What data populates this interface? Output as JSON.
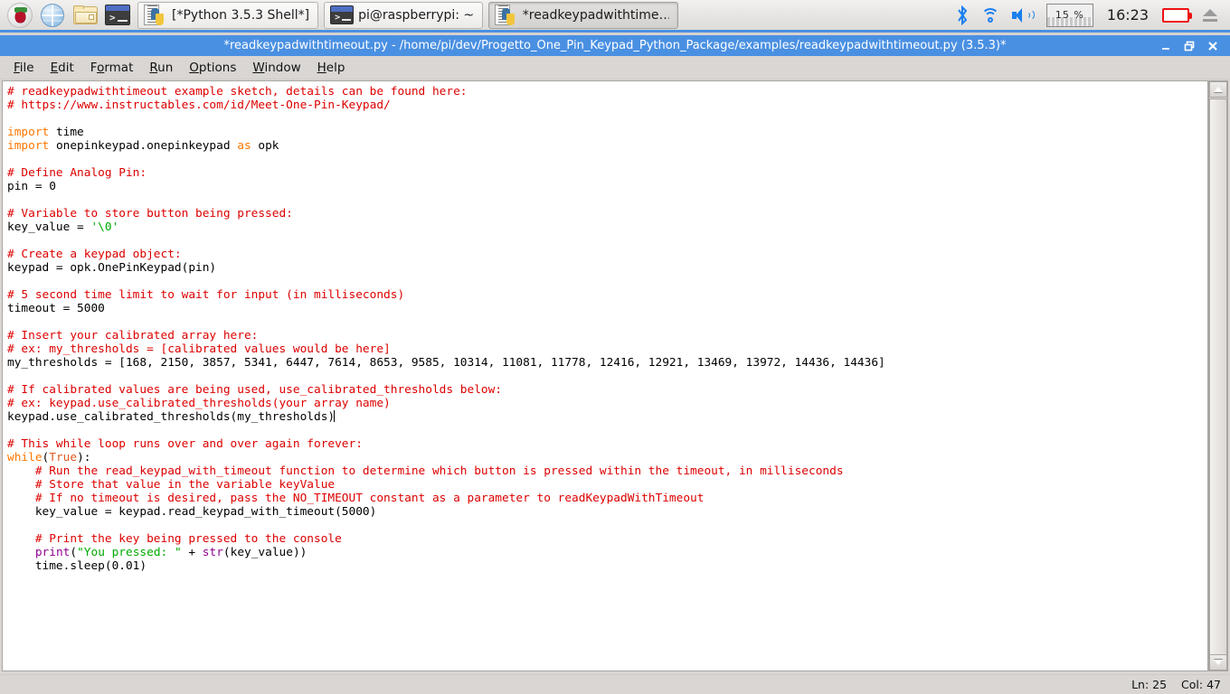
{
  "taskbar": {
    "launchers": [
      {
        "name": "raspberry-menu-icon",
        "label": "Raspberry Pi Menu"
      },
      {
        "name": "web-browser-icon",
        "label": "Web Browser"
      },
      {
        "name": "file-manager-icon",
        "label": "File Manager"
      },
      {
        "name": "terminal-icon",
        "label": "Terminal"
      }
    ],
    "windows": [
      {
        "label": "[*Python 3.5.3 Shell*]",
        "icon": "python-idle-icon",
        "active": false
      },
      {
        "label": "pi@raspberrypi: ~",
        "icon": "terminal-icon",
        "active": false
      },
      {
        "label": "*readkeypadwithtime…",
        "icon": "python-idle-icon",
        "active": true
      }
    ],
    "tray": {
      "bluetooth": "bluetooth-icon",
      "wifi": "wifi-icon",
      "volume": "volume-icon",
      "cpu_label": "15 %",
      "clock": "16:23",
      "battery": "battery-icon",
      "eject": "eject-icon"
    }
  },
  "window": {
    "title": "*readkeypadwithtimeout.py - /home/pi/dev/Progetto_One_Pin_Keypad_Python_Package/examples/readkeypadwithtimeout.py (3.5.3)*",
    "buttons": {
      "minimize": "minimize-button",
      "maximize": "maximize-button",
      "close": "close-button"
    }
  },
  "menubar": [
    {
      "label": "File",
      "mnemonic": "F"
    },
    {
      "label": "Edit",
      "mnemonic": "E"
    },
    {
      "label": "Format",
      "mnemonic": "o"
    },
    {
      "label": "Run",
      "mnemonic": "R"
    },
    {
      "label": "Options",
      "mnemonic": "O"
    },
    {
      "label": "Window",
      "mnemonic": "W"
    },
    {
      "label": "Help",
      "mnemonic": "H"
    }
  ],
  "statusbar": {
    "line_label": "Ln: 25",
    "col_label": "Col: 47"
  },
  "editor": {
    "language": "python",
    "colors": {
      "comment": "#dd0000",
      "keyword": "#ff7700",
      "builtin": "#900090",
      "string": "#00aa00",
      "definition": "#e05a20",
      "text": "#000000",
      "background": "#ffffff"
    },
    "thresholds": [
      168,
      2150,
      3857,
      5341,
      6447,
      7614,
      8653,
      9585,
      10314,
      11081,
      11778,
      12416,
      12921,
      13469,
      13972,
      14436,
      14436
    ],
    "lines": [
      [
        {
          "t": "# readkeypadwithtimeout example sketch, details can be found here:",
          "c": "c"
        }
      ],
      [
        {
          "t": "# https://www.instructables.com/id/Meet-One-Pin-Keypad/",
          "c": "c"
        }
      ],
      [],
      [
        {
          "t": "import",
          "c": "k"
        },
        {
          "t": " time",
          "c": "n"
        }
      ],
      [
        {
          "t": "import",
          "c": "k"
        },
        {
          "t": " onepinkeypad.onepinkeypad ",
          "c": "n"
        },
        {
          "t": "as",
          "c": "k"
        },
        {
          "t": " opk",
          "c": "n"
        }
      ],
      [],
      [
        {
          "t": "# Define Analog Pin:",
          "c": "c"
        }
      ],
      [
        {
          "t": "pin = 0",
          "c": "n"
        }
      ],
      [],
      [
        {
          "t": "# Variable to store button being pressed:",
          "c": "c"
        }
      ],
      [
        {
          "t": "key_value = ",
          "c": "n"
        },
        {
          "t": "'\\0'",
          "c": "s"
        }
      ],
      [],
      [
        {
          "t": "# Create a keypad object:",
          "c": "c"
        }
      ],
      [
        {
          "t": "keypad = opk.OnePinKeypad(pin)",
          "c": "n"
        }
      ],
      [],
      [
        {
          "t": "# 5 second time limit to wait for input (in milliseconds)",
          "c": "c"
        }
      ],
      [
        {
          "t": "timeout = 5000",
          "c": "n"
        }
      ],
      [],
      [
        {
          "t": "# Insert your calibrated array here:",
          "c": "c"
        }
      ],
      [
        {
          "t": "# ex: my_thresholds = [calibrated values would be here]",
          "c": "c"
        }
      ],
      [
        {
          "t": "my_thresholds = [168, 2150, 3857, 5341, 6447, 7614, 8653, 9585, 10314, 11081, 11778, 12416, 12921, 13469, 13972, 14436, 14436]",
          "c": "n"
        }
      ],
      [],
      [
        {
          "t": "# If calibrated values are being used, use_calibrated_thresholds below:",
          "c": "c"
        }
      ],
      [
        {
          "t": "# ex: keypad.use_calibrated_thresholds(your array name)",
          "c": "c"
        }
      ],
      [
        {
          "t": "keypad.use_calibrated_thresholds(my_thresholds)",
          "c": "n"
        },
        {
          "t": "",
          "c": "caret"
        }
      ],
      [],
      [
        {
          "t": "# This while loop runs over and over again forever:",
          "c": "c"
        }
      ],
      [
        {
          "t": "while",
          "c": "k"
        },
        {
          "t": "(",
          "c": "n"
        },
        {
          "t": "True",
          "c": "d"
        },
        {
          "t": "):",
          "c": "n"
        }
      ],
      [
        {
          "t": "    # Run the read_keypad_with_timeout function to determine which button is pressed within the timeout, in milliseconds",
          "c": "c"
        }
      ],
      [
        {
          "t": "    # Store that value in the variable keyValue",
          "c": "c"
        }
      ],
      [
        {
          "t": "    # If no timeout is desired, pass the NO_TIMEOUT constant as a parameter to readKeypadWithTimeout",
          "c": "c"
        }
      ],
      [
        {
          "t": "    key_value = keypad.read_keypad_with_timeout(5000)",
          "c": "n"
        }
      ],
      [],
      [
        {
          "t": "    # Print the key being pressed to the console",
          "c": "c"
        }
      ],
      [
        {
          "t": "    ",
          "c": "n"
        },
        {
          "t": "print",
          "c": "b"
        },
        {
          "t": "(",
          "c": "n"
        },
        {
          "t": "\"You pressed: \"",
          "c": "s"
        },
        {
          "t": " + ",
          "c": "n"
        },
        {
          "t": "str",
          "c": "b"
        },
        {
          "t": "(key_value))",
          "c": "n"
        }
      ],
      [
        {
          "t": "    time.sleep(0.01)",
          "c": "n"
        }
      ]
    ]
  }
}
